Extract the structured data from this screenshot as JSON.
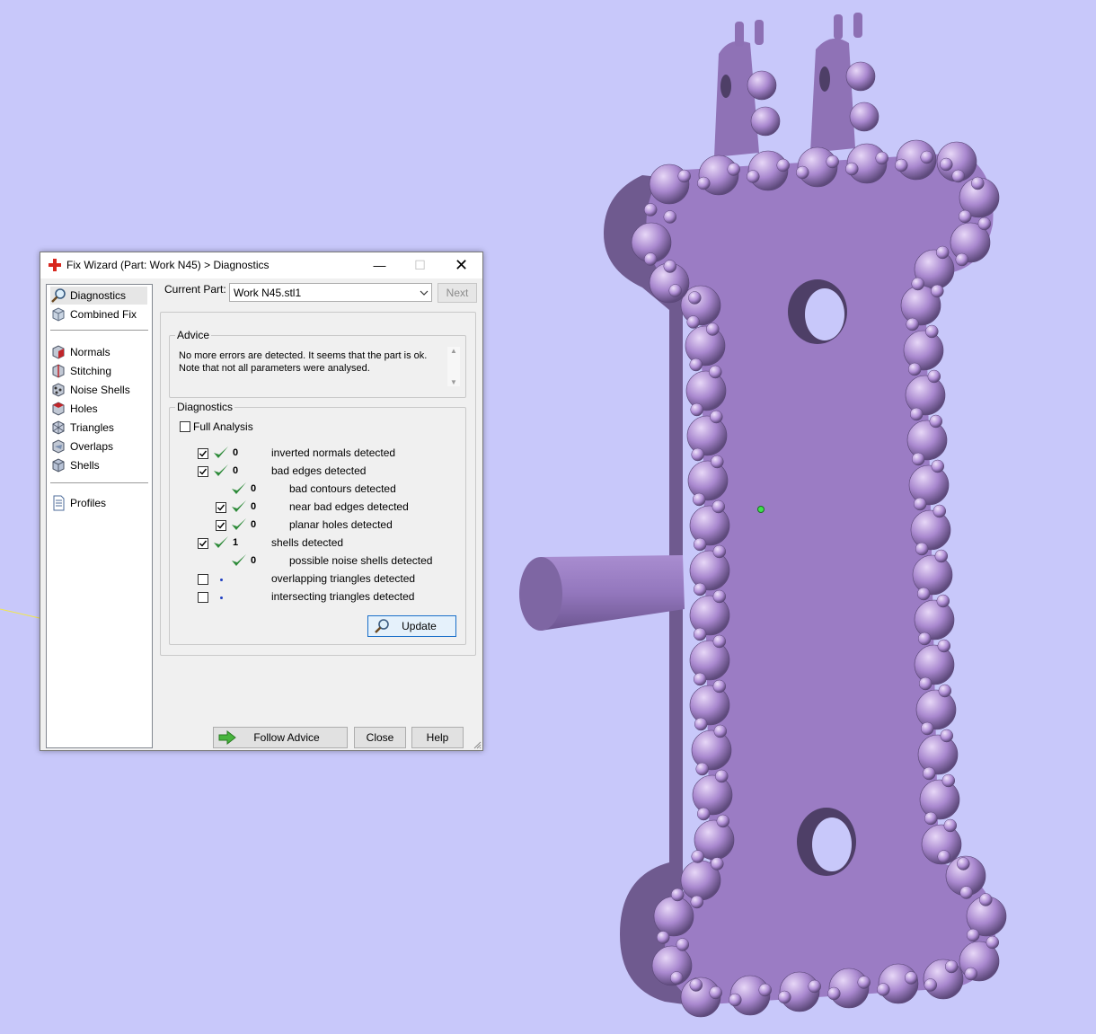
{
  "dialog": {
    "title": "Fix Wizard (Part: Work N45) > Diagnostics",
    "title_icon": "red-cross-icon",
    "window_buttons": {
      "minimize": "—",
      "maximize": "☐",
      "close": "✕"
    }
  },
  "nav": {
    "top_items": [
      {
        "label": "Diagnostics",
        "icon": "magnifier-icon",
        "selected": true
      },
      {
        "label": "Combined Fix",
        "icon": "cube-icon"
      }
    ],
    "fix_items": [
      {
        "label": "Normals",
        "icon": "normals-cube-icon"
      },
      {
        "label": "Stitching",
        "icon": "stitching-icon"
      },
      {
        "label": "Noise Shells",
        "icon": "noise-shells-icon"
      },
      {
        "label": "Holes",
        "icon": "holes-icon"
      },
      {
        "label": "Triangles",
        "icon": "triangles-icon"
      },
      {
        "label": "Overlaps",
        "icon": "overlaps-icon"
      },
      {
        "label": "Shells",
        "icon": "shells-icon"
      }
    ],
    "bottom_items": [
      {
        "label": "Profiles",
        "icon": "document-icon"
      }
    ]
  },
  "header": {
    "current_part_label": "Current Part:",
    "current_part_value": "Work N45.stl1",
    "next_button": "Next"
  },
  "advice": {
    "title": "Advice",
    "lines": [
      "No more errors are detected. It seems that the part is ok.",
      "Note that not all parameters were analysed."
    ]
  },
  "diagnostics": {
    "title": "Diagnostics",
    "full_analysis_label": "Full Analysis",
    "full_analysis_checked": false,
    "rows": [
      {
        "checkbox": true,
        "checked": true,
        "status": "ok",
        "value": "0",
        "label": "inverted normals detected",
        "indent": 0
      },
      {
        "checkbox": true,
        "checked": true,
        "status": "ok",
        "value": "0",
        "label": "bad edges detected",
        "indent": 0
      },
      {
        "checkbox": false,
        "checked": false,
        "status": "ok",
        "value": "0",
        "label": "bad contours detected",
        "indent": 1
      },
      {
        "checkbox": true,
        "checked": true,
        "status": "ok",
        "value": "0",
        "label": "near bad edges detected",
        "indent": 1
      },
      {
        "checkbox": true,
        "checked": true,
        "status": "ok",
        "value": "0",
        "label": "planar holes detected",
        "indent": 1
      },
      {
        "checkbox": true,
        "checked": true,
        "status": "ok",
        "value": "1",
        "label": "shells detected",
        "indent": 0
      },
      {
        "checkbox": false,
        "checked": false,
        "status": "ok",
        "value": "0",
        "label": "possible noise shells detected",
        "indent": 1
      },
      {
        "checkbox": true,
        "checked": false,
        "status": "pending",
        "value": "",
        "label": "overlapping triangles detected",
        "indent": 0
      },
      {
        "checkbox": true,
        "checked": false,
        "status": "pending",
        "value": "",
        "label": "intersecting triangles detected",
        "indent": 0
      }
    ],
    "update_button": "Update"
  },
  "footer": {
    "follow_advice": "Follow Advice",
    "close": "Close",
    "help": "Help"
  },
  "colors": {
    "viewport_bg": "#c8c8fa",
    "model_face": "#9b7cc4",
    "model_side": "#6f5a8f",
    "bead": "#b28fd6",
    "check_green": "#2e8b3a",
    "dialog_bg": "#f0f0f0"
  }
}
